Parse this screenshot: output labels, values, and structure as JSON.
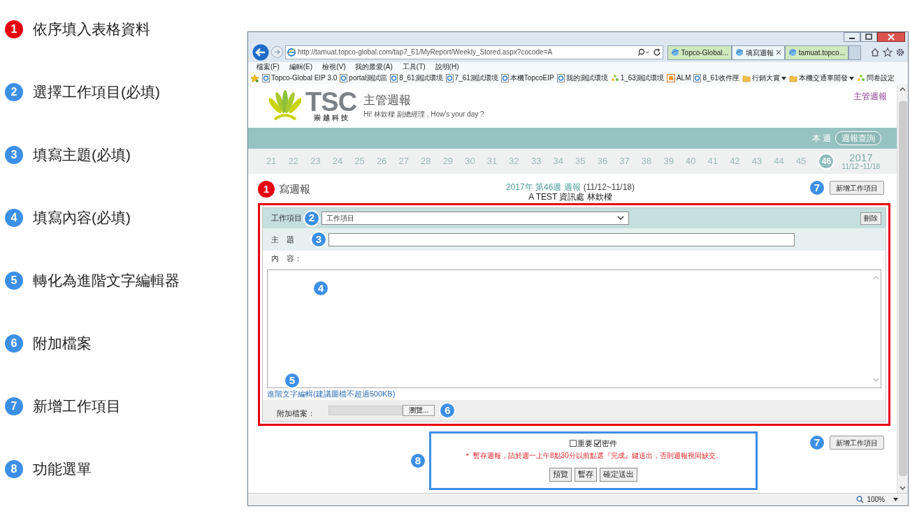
{
  "legend": [
    {
      "number": "1",
      "text": "依序填入表格資料",
      "color": "#e60012"
    },
    {
      "number": "2",
      "text": "選擇工作項目(必填)",
      "color": "#3d8fe6"
    },
    {
      "number": "3",
      "text": "填寫主題(必填)",
      "color": "#3d8fe6"
    },
    {
      "number": "4",
      "text": "填寫內容(必填)",
      "color": "#3d8fe6"
    },
    {
      "number": "5",
      "text": "轉化為進階文字編輯器",
      "color": "#3d8fe6"
    },
    {
      "number": "6",
      "text": "附加檔案",
      "color": "#3d8fe6"
    },
    {
      "number": "7",
      "text": "新增工作項目",
      "color": "#3d8fe6"
    },
    {
      "number": "8",
      "text": "功能選單",
      "color": "#3d8fe6"
    }
  ],
  "browser": {
    "address": "http://tamuat.topco-global.com/tap7_61/MyReport/Weekly_Stored.aspx?cocode=A",
    "tabs": [
      {
        "label": "Topco-Global...",
        "selected": false
      },
      {
        "label": "填寫週報",
        "selected": true
      },
      {
        "label": "tamuat.topco...",
        "selected": false
      }
    ],
    "menu": [
      "檔案(F)",
      "編輯(E)",
      "檢視(V)",
      "我的最愛(A)",
      "工具(T)",
      "說明(H)"
    ],
    "favorites": [
      {
        "label": "Topco-Global EIP 3.0",
        "kind": "page"
      },
      {
        "label": "portal測試區",
        "kind": "page"
      },
      {
        "label": "8_61測試環境",
        "kind": "page"
      },
      {
        "label": "7_61測試環境",
        "kind": "page"
      },
      {
        "label": "本機TopcoEIP",
        "kind": "page"
      },
      {
        "label": "我的測試環境",
        "kind": "page"
      },
      {
        "label": "1_63測試環境",
        "kind": "feed"
      },
      {
        "label": "ALM",
        "kind": "app"
      },
      {
        "label": "8_61收件匣",
        "kind": "page"
      },
      {
        "label": "行銷大賞",
        "kind": "folder"
      },
      {
        "label": "本機交通車開發",
        "kind": "folder"
      },
      {
        "label": "問卷設定",
        "kind": "feed"
      }
    ],
    "zoom": "100%"
  },
  "header": {
    "logo": "TSC",
    "logo_subtitle": "崇 越 科 技",
    "title": "主管週報",
    "greeting": "Hi! 林欽樑 副總經理 , How's your day ?",
    "top_link": "主管週報"
  },
  "week_bar": {
    "this_week": "本 週",
    "query_button": "週報查詢"
  },
  "weeks": [
    {
      "label": "21",
      "selected": false
    },
    {
      "label": "22",
      "selected": false
    },
    {
      "label": "23",
      "selected": false
    },
    {
      "label": "24",
      "selected": false
    },
    {
      "label": "25",
      "selected": false
    },
    {
      "label": "26",
      "selected": false
    },
    {
      "label": "27",
      "selected": false
    },
    {
      "label": "28",
      "selected": false
    },
    {
      "label": "29",
      "selected": false
    },
    {
      "label": "30",
      "selected": false
    },
    {
      "label": "31",
      "selected": false
    },
    {
      "label": "32",
      "selected": false
    },
    {
      "label": "33",
      "selected": false
    },
    {
      "label": "34",
      "selected": false
    },
    {
      "label": "35",
      "selected": false
    },
    {
      "label": "36",
      "selected": false
    },
    {
      "label": "37",
      "selected": false
    },
    {
      "label": "38",
      "selected": false
    },
    {
      "label": "39",
      "selected": false
    },
    {
      "label": "40",
      "selected": false
    },
    {
      "label": "41",
      "selected": false
    },
    {
      "label": "42",
      "selected": false
    },
    {
      "label": "43",
      "selected": false
    },
    {
      "label": "44",
      "selected": false
    },
    {
      "label": "45",
      "selected": false
    },
    {
      "label": "46",
      "selected": true
    }
  ],
  "year": "2017",
  "range": "11/12~11/18",
  "report": {
    "heading": "寫週報",
    "title": "2017年 第46週 週報",
    "dates": "(11/12~11/18)",
    "subtitle": "A TEST 資訊處 林欽樑",
    "add_button": "新增工作項目"
  },
  "form": {
    "item_label": "工作項目",
    "item_value": "工作項目",
    "delete_button": "刪除",
    "subject_label": "主　題",
    "content_label": "內　容：",
    "editor_link": "進階文字編輯(建議圖檔不超過500KB)",
    "attach_label": "附加檔案：",
    "browse_button": "瀏覽..."
  },
  "bottom": {
    "add_button": "新增工作項目",
    "checks": [
      {
        "label": "重要",
        "checked": false
      },
      {
        "label": "密件",
        "checked": true
      }
    ],
    "notice": "＊ 暫存週報，請於週一上午8點30分以前點選『完成』鍵送出，否則週報視同缺交。",
    "buttons": [
      "預覽",
      "暫存",
      "確定送出"
    ]
  },
  "screen_callouts": [
    {
      "label": "1",
      "color": "#e60012"
    },
    {
      "label": "7",
      "color": "#3d8fe6"
    },
    {
      "label": "2",
      "color": "#3d8fe6"
    },
    {
      "label": "3",
      "color": "#3d8fe6"
    },
    {
      "label": "4",
      "color": "#3d8fe6"
    },
    {
      "label": "5",
      "color": "#3d8fe6"
    },
    {
      "label": "6",
      "color": "#3d8fe6"
    },
    {
      "label": "7",
      "color": "#3d8fe6"
    },
    {
      "label": "8",
      "color": "#3d8fe6"
    }
  ]
}
